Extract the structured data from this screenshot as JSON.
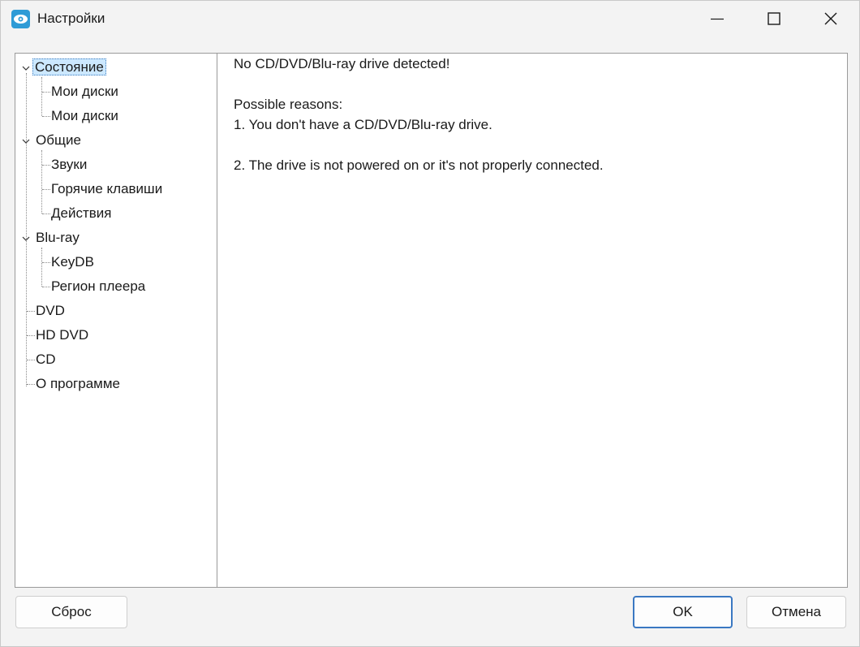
{
  "window": {
    "title": "Настройки"
  },
  "tree": {
    "items": [
      {
        "label": "Состояние"
      },
      {
        "label": "Мои диски"
      },
      {
        "label": "Мои диски"
      },
      {
        "label": "Общие"
      },
      {
        "label": "Звуки"
      },
      {
        "label": "Горячие клавиши"
      },
      {
        "label": "Действия"
      },
      {
        "label": "Blu-ray"
      },
      {
        "label": "KeyDB"
      },
      {
        "label": "Регион плеера"
      },
      {
        "label": "DVD"
      },
      {
        "label": "HD DVD"
      },
      {
        "label": "CD"
      },
      {
        "label": "О программе"
      }
    ]
  },
  "content": {
    "line1": "No CD/DVD/Blu-ray drive detected!",
    "line2": "Possible reasons:",
    "line3": "1. You don't have a CD/DVD/Blu-ray drive.",
    "line4": "2. The drive is not powered on or it's not properly connected."
  },
  "footer": {
    "reset_label": "Сброс",
    "ok_label": "OK",
    "cancel_label": "Отмена"
  },
  "colors": {
    "accent": "#3a78c2",
    "selection": "#cce8ff",
    "app_icon": "#2e9bd6"
  }
}
